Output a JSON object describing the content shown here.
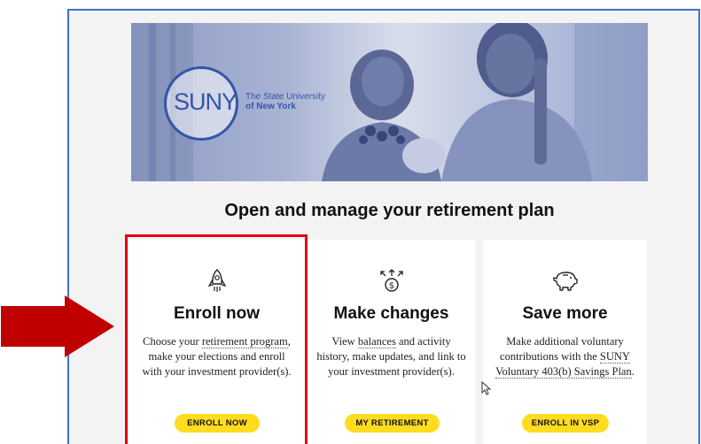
{
  "hero": {
    "logo_text": "SUNY",
    "logo_tagline_line1": "The State University",
    "logo_tagline_line2": "of New York"
  },
  "headline": "Open and manage your retirement plan",
  "cards": [
    {
      "icon": "rocket-icon",
      "title": "Enroll now",
      "body_pre": "Choose your ",
      "body_link": "retirement program",
      "body_post": ", make your elections and enroll with your investment provider(s).",
      "button": "ENROLL NOW"
    },
    {
      "icon": "dollar-arrows-icon",
      "title": "Make changes",
      "body_pre": "View ",
      "body_link": "balances",
      "body_post": " and activity history, make updates, and link to your investment provider(s).",
      "button": "MY RETIREMENT"
    },
    {
      "icon": "piggy-bank-icon",
      "title": "Save more",
      "body_pre": "Make additional voluntary contributions with the ",
      "body_link": "SUNY Voluntary 403(b) Savings Plan",
      "body_post": ".",
      "button": "ENROLL IN VSP"
    }
  ],
  "colors": {
    "accent_button": "#ffdc1f",
    "highlight_box": "#e0001b",
    "annotation_arrow": "#c00000",
    "brand_blue": "#3455a8",
    "frame_border": "#4472c4"
  }
}
